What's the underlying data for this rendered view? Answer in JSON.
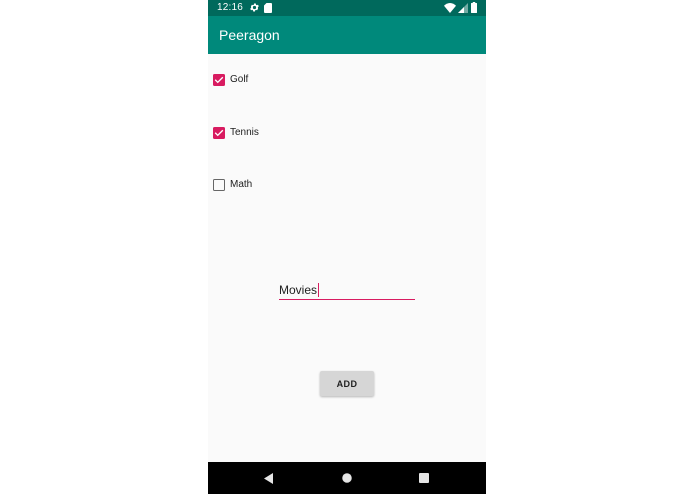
{
  "status_bar": {
    "time": "12:16",
    "icons": [
      "gear-icon",
      "sd-card-icon",
      "wifi-icon",
      "signal-icon",
      "battery-icon"
    ]
  },
  "app_bar": {
    "title": "Peeragon",
    "color": "#00897b",
    "status_color": "#00695c"
  },
  "checkboxes": [
    {
      "label": "Golf",
      "checked": true
    },
    {
      "label": "Tennis",
      "checked": true
    },
    {
      "label": "Math",
      "checked": false
    }
  ],
  "input": {
    "value": "Movies",
    "accent": "#d81b60"
  },
  "add_button": {
    "label": "ADD"
  },
  "nav_bar": {
    "icons": [
      "back-icon",
      "home-icon",
      "recents-icon"
    ]
  }
}
